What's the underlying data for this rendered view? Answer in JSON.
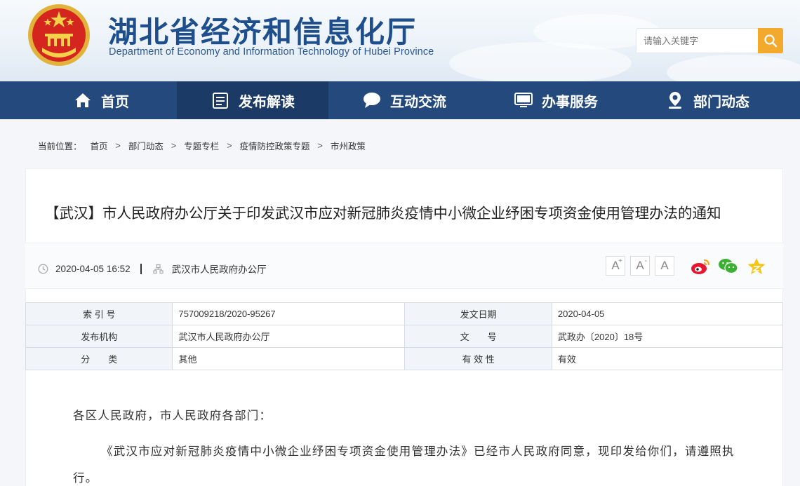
{
  "header": {
    "title": "湖北省经济和信息化厅",
    "subtitle": "Department of Economy and Information Technology of Hubei Province",
    "search_placeholder": "请输入关键字",
    "brand_color": "#1e4f8c",
    "search_button_color": "#f3a92b"
  },
  "nav": {
    "items": [
      {
        "label": "首页",
        "icon": "home-icon"
      },
      {
        "label": "发布解读",
        "icon": "document-icon"
      },
      {
        "label": "互动交流",
        "icon": "chat-bubble-icon"
      },
      {
        "label": "办事服务",
        "icon": "monitor-icon"
      },
      {
        "label": "部门动态",
        "icon": "location-pin-icon"
      }
    ],
    "active_index": 1,
    "background_color": "#244a7d"
  },
  "breadcrumb": {
    "prefix": "当前位置：",
    "items": [
      "首页",
      "部门动态",
      "专题专栏",
      "疫情防控政策专题",
      "市州政策"
    ],
    "separator": ">"
  },
  "article": {
    "title": "【武汉】市人民政府办公厅关于印发武汉市应对新冠肺炎疫情中小微企业纾困专项资金使用管理办法的通知",
    "date": "2020-04-05 16:52",
    "source": "武汉市人民政府办公厅",
    "font_buttons": [
      "A+",
      "A-",
      "A"
    ],
    "share_icons": [
      "weibo-icon",
      "wechat-icon",
      "star-icon"
    ]
  },
  "info_table": {
    "rows": [
      {
        "label1": "索 引 号",
        "value1": "757009218/2020-95267",
        "label2": "发文日期",
        "value2": "2020-04-05"
      },
      {
        "label1": "发布机构",
        "value1": "武汉市人民政府办公厅",
        "label2": "文　　号",
        "value2": "武政办〔2020〕18号"
      },
      {
        "label1": "分　　类",
        "value1": "其他",
        "label2": "有 效 性",
        "value2": "有效"
      }
    ]
  },
  "body": {
    "salutation": "各区人民政府，市人民政府各部门：",
    "paragraph1": "《武汉市应对新冠肺炎疫情中小微企业纾困专项资金使用管理办法》已经市人民政府同意，现印发给你们，请遵照执行。"
  }
}
